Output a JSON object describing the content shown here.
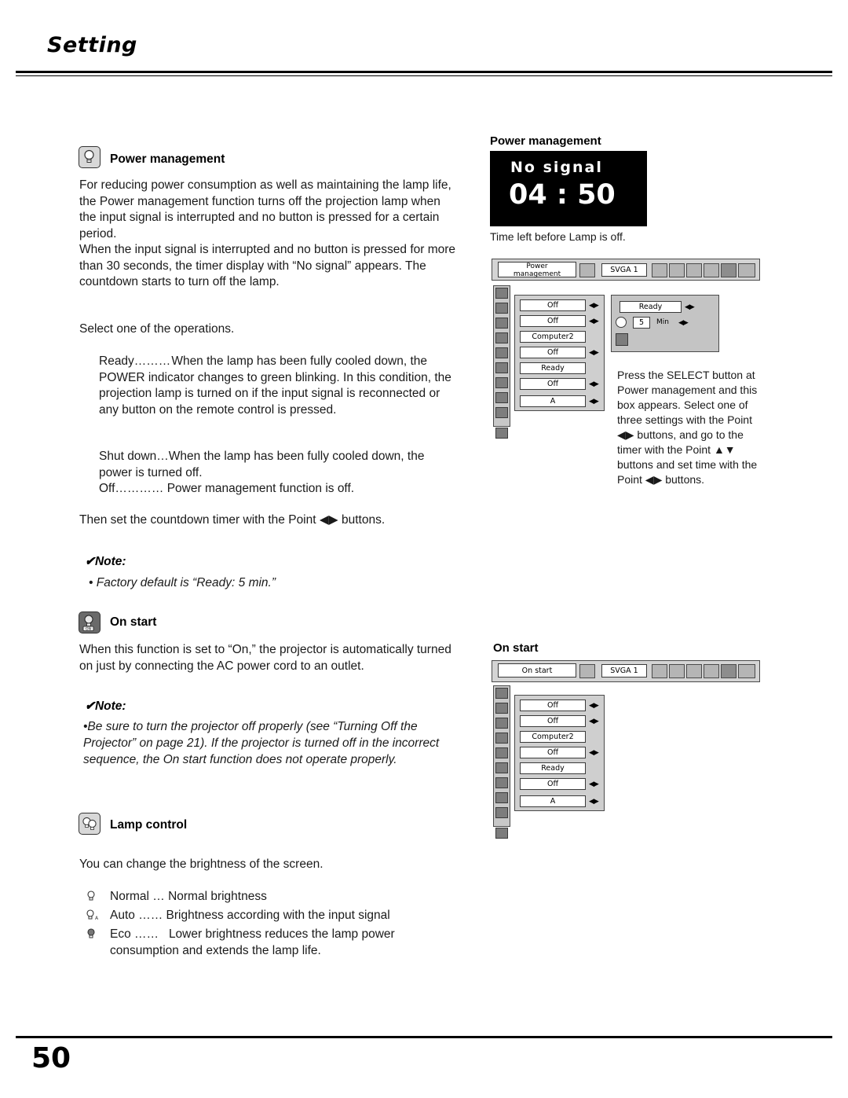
{
  "header": {
    "title": "Setting"
  },
  "footer": {
    "page_number": "50"
  },
  "left_column": {
    "power_management": {
      "heading": "Power management",
      "icon": "lamp-icon",
      "paragraph1": "For reducing power consumption as well as maintaining the lamp life, the Power management function turns off the projection lamp when the input signal is interrupted and no button is pressed for a certain period.",
      "paragraph2": "When the input signal is interrupted and no button is pressed for more than 30 seconds, the timer display with “No signal” appears. The countdown starts to turn off the lamp.",
      "paragraph3": "Select one of the operations.",
      "options": [
        {
          "term": "Ready………",
          "desc": "When the lamp has been fully cooled down, the POWER indicator changes to green blinking. In this condition, the projection lamp is turned on if the input signal is reconnected or any button on the remote control is pressed."
        },
        {
          "term": "Shut down…",
          "desc": "When the lamp has been fully cooled down, the power is turned off."
        },
        {
          "term": "Off…………",
          "desc": "Power management function is off."
        }
      ],
      "paragraph4": "Then set the countdown timer with the Point ◀▶ buttons.",
      "note_heading": "✔Note:",
      "note_text": "• Factory default is “Ready: 5 min.”"
    },
    "on_start": {
      "heading": "On start",
      "icon": "on-start-icon",
      "paragraph": "When this function is set to “On,” the projector is automatically turned on just by connecting the AC power cord to an outlet.",
      "note_heading": "✔Note:",
      "note_text": "•Be sure to turn the projector off properly (see “Turning Off the Projector” on page 21). If the projector is turned off in the incorrect sequence, the On start function does not operate properly."
    },
    "lamp_control": {
      "heading": "Lamp control",
      "icon": "lamp-control-icon",
      "paragraph": "You can change the brightness of the screen.",
      "modes": [
        {
          "icon": "lamp-normal-icon",
          "term": "Normal …",
          "desc": "Normal brightness"
        },
        {
          "icon": "lamp-auto-icon",
          "term": "Auto ……",
          "desc": "Brightness according with the input signal"
        },
        {
          "icon": "lamp-eco-icon",
          "term": "Eco ……",
          "desc": "Lower brightness reduces the lamp power consumption and extends the lamp life."
        }
      ]
    }
  },
  "right_column": {
    "power_management_figure": {
      "caption": "Power management",
      "no_signal_text": "No signal",
      "countdown": "04 : 50",
      "sub_caption": "Time left before Lamp is off.",
      "menu": {
        "tab_label_line1": "Power",
        "tab_label_line2": "management",
        "input_label": "SVGA 1",
        "items": [
          "Off",
          "Off",
          "Computer2",
          "Off",
          "Ready",
          "Off",
          "A"
        ],
        "panel_value": "Ready",
        "timer_value": "5",
        "timer_unit": "Min"
      },
      "description": "Press the SELECT button at Power management and this box appears.  Select one of three settings with the Point ◀▶ buttons, and go to the timer with the Point ▲▼ buttons and set time with the Point ◀▶ buttons."
    },
    "on_start_figure": {
      "caption": "On start",
      "menu": {
        "tab_label": "On start",
        "input_label": "SVGA 1",
        "items": [
          "Off",
          "Off",
          "Computer2",
          "Off",
          "Ready",
          "Off",
          "A"
        ]
      }
    }
  }
}
